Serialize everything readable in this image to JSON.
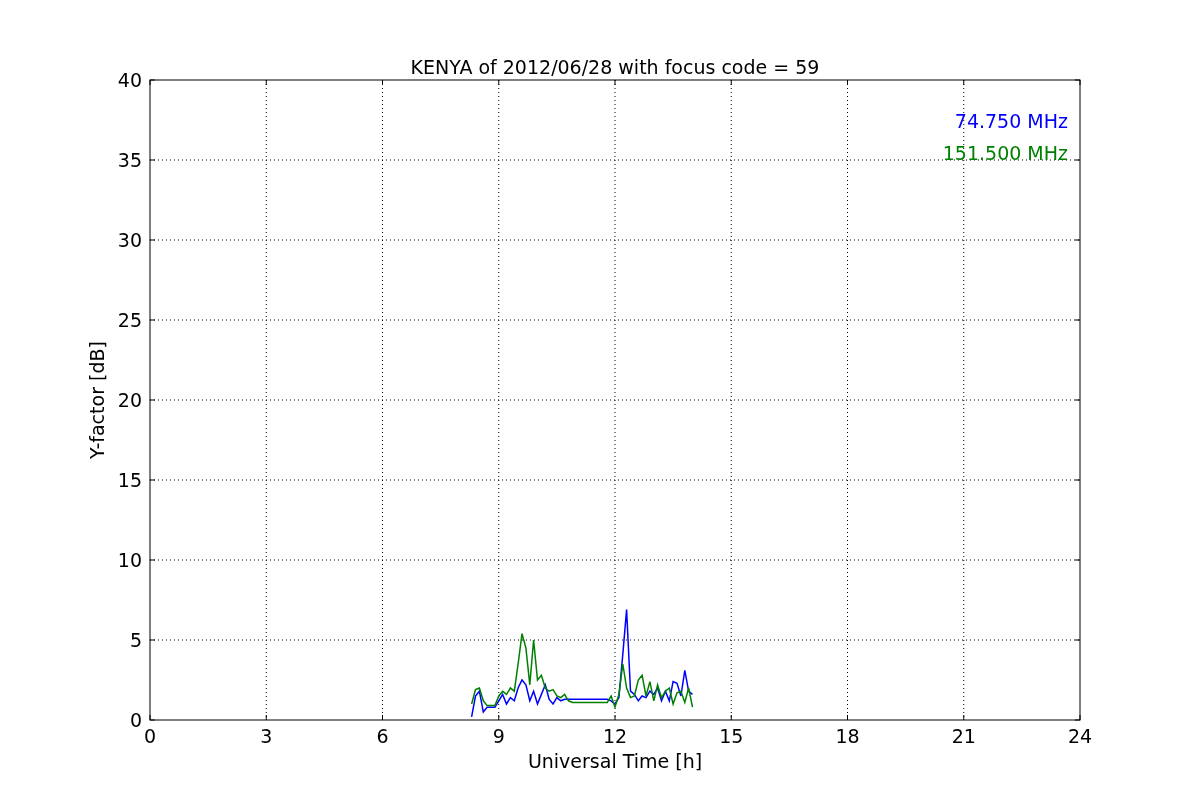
{
  "chart_data": {
    "type": "line",
    "title": "KENYA of 2012/06/28 with focus code = 59",
    "xlabel": "Universal Time [h]",
    "ylabel": "Y-factor [dB]",
    "x": [
      8.3,
      8.4,
      8.5,
      8.6,
      8.7,
      8.8,
      8.9,
      9.0,
      9.1,
      9.2,
      9.3,
      9.4,
      9.5,
      9.6,
      9.7,
      9.8,
      9.9,
      10.0,
      10.1,
      10.2,
      10.3,
      10.4,
      10.5,
      10.6,
      10.7,
      10.8,
      10.9,
      11.0,
      11.1,
      11.2,
      11.3,
      11.4,
      11.5,
      11.6,
      11.7,
      11.8,
      11.9,
      12.0,
      12.1,
      12.2,
      12.3,
      12.4,
      12.5,
      12.6,
      12.7,
      12.8,
      12.9,
      13.0,
      13.1,
      13.2,
      13.3,
      13.4,
      13.5,
      13.6,
      13.7,
      13.8,
      13.9,
      14.0
    ],
    "series": [
      {
        "name": "74.750 MHz",
        "color": "#0000ff",
        "values": [
          0.2,
          1.5,
          1.8,
          0.5,
          0.8,
          0.8,
          0.8,
          1.2,
          1.6,
          1.0,
          1.4,
          1.2,
          2.0,
          2.5,
          2.2,
          1.2,
          1.8,
          1.0,
          1.6,
          2.2,
          1.3,
          1.0,
          1.4,
          1.2,
          1.3,
          1.3,
          1.3,
          1.3,
          1.3,
          1.3,
          1.3,
          1.3,
          1.3,
          1.3,
          1.3,
          1.3,
          1.2,
          1.0,
          1.4,
          4.1,
          6.9,
          1.8,
          1.6,
          1.2,
          1.5,
          1.4,
          1.8,
          1.6,
          2.0,
          1.2,
          1.8,
          1.2,
          2.4,
          2.3,
          1.5,
          3.1,
          1.8,
          1.6
        ]
      },
      {
        "name": "151.500 MHz",
        "color": "#008000",
        "values": [
          1.0,
          1.9,
          2.0,
          1.2,
          0.9,
          0.9,
          0.9,
          1.5,
          1.8,
          1.6,
          2.0,
          1.8,
          3.5,
          5.4,
          4.5,
          2.2,
          5.0,
          2.5,
          2.8,
          2.0,
          1.8,
          1.9,
          1.5,
          1.4,
          1.6,
          1.2,
          1.1,
          1.1,
          1.1,
          1.1,
          1.1,
          1.1,
          1.1,
          1.1,
          1.1,
          1.1,
          1.5,
          0.8,
          1.6,
          3.5,
          2.0,
          1.4,
          1.5,
          2.5,
          2.8,
          1.5,
          2.4,
          1.2,
          2.2,
          1.4,
          1.8,
          2.0,
          1.0,
          1.7,
          1.8,
          1.1,
          2.0,
          0.8
        ]
      }
    ],
    "xlim": [
      0,
      24
    ],
    "ylim": [
      0,
      40
    ],
    "xticks": [
      0,
      3,
      6,
      9,
      12,
      15,
      18,
      21,
      24
    ],
    "yticks": [
      0,
      5,
      10,
      15,
      20,
      25,
      30,
      35,
      40
    ],
    "grid": true
  }
}
